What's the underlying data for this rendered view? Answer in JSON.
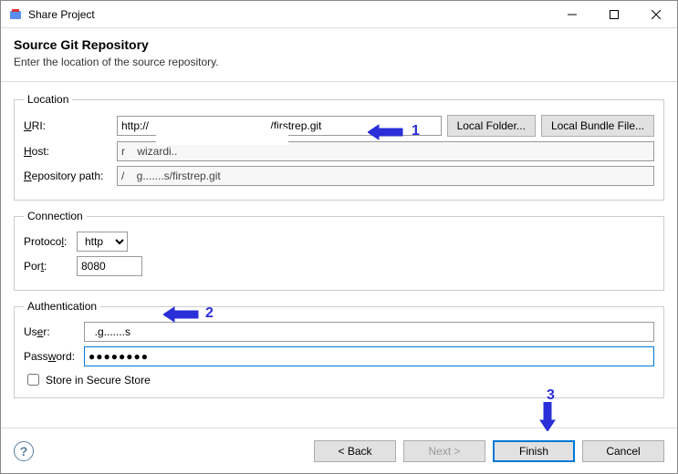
{
  "window": {
    "title": "Share Project"
  },
  "header": {
    "title": "Source Git Repository",
    "subtitle": "Enter the location of the source repository."
  },
  "location": {
    "legend": "Location",
    "uri_label": "URI:",
    "uri_value": "http://                                        /firstrep.git",
    "local_folder_btn": "Local Folder...",
    "local_bundle_btn": "Local Bundle File...",
    "host_label": "Host:",
    "host_value": "r    wizardi..",
    "repo_label": "Repository path:",
    "repo_value": "/    g.......s/firstrep.git"
  },
  "connection": {
    "legend": "Connection",
    "protocol_label": "Protocol:",
    "protocol_value": "http",
    "port_label": "Port:",
    "port_value": "8080"
  },
  "auth": {
    "legend": "Authentication",
    "user_label": "User:",
    "user_value": "  .g.......s",
    "password_label": "Password:",
    "password_value": "●●●●●●●●",
    "store_label": "Store in Secure Store"
  },
  "footer": {
    "back": "< Back",
    "next": "Next >",
    "finish": "Finish",
    "cancel": "Cancel"
  },
  "annotations": {
    "a1": "1",
    "a2": "2",
    "a3": "3"
  }
}
